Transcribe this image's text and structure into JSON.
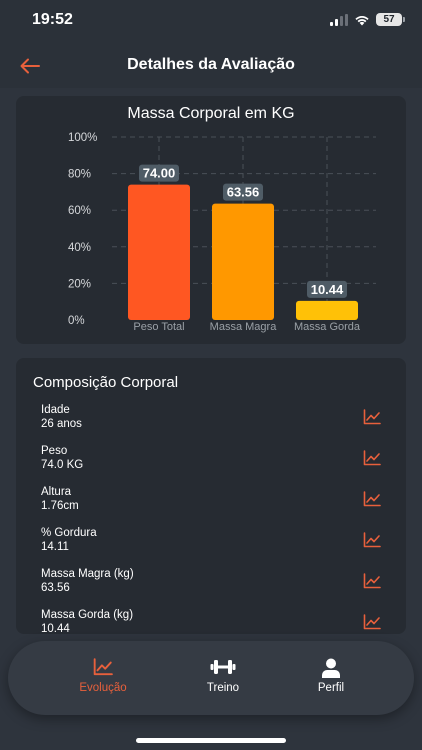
{
  "status": {
    "time": "19:52",
    "battery": "57"
  },
  "header": {
    "title": "Detalhes da Avaliação"
  },
  "chart_data": {
    "type": "bar",
    "title": "Massa Corporal em KG",
    "categories": [
      "Peso Total",
      "Massa Magra",
      "Massa Gorda"
    ],
    "values": [
      74.0,
      63.56,
      10.44
    ],
    "value_labels": [
      "74.00",
      "63.56",
      "10.44"
    ],
    "colors": [
      "#ff5722",
      "#ff9800",
      "#ffc107"
    ],
    "y_ticks": [
      "100%",
      "80%",
      "60%",
      "40%",
      "20%",
      "0%"
    ],
    "ylim": [
      0,
      100
    ],
    "grid": true
  },
  "composition": {
    "title": "Composição Corporal",
    "rows": [
      {
        "label": "Idade",
        "value": "26 anos",
        "icon": "chart-line-icon"
      },
      {
        "label": "Peso",
        "value": "74.0 KG",
        "icon": "chart-line-icon"
      },
      {
        "label": "Altura",
        "value": "1.76cm",
        "icon": "chart-line-icon"
      },
      {
        "label": "% Gordura",
        "value": "14.11",
        "icon": "chart-line-icon"
      },
      {
        "label": "Massa Magra (kg)",
        "value": "63.56",
        "icon": "chart-line-icon"
      },
      {
        "label": "Massa Gorda (kg)",
        "value": "10.44",
        "icon": "chart-line-icon"
      }
    ]
  },
  "nav": {
    "items": [
      {
        "label": "Evolução",
        "icon": "chart-line-icon",
        "active": true
      },
      {
        "label": "Treino",
        "icon": "dumbbell-icon",
        "active": false
      },
      {
        "label": "Perfil",
        "icon": "user-icon",
        "active": false
      }
    ]
  },
  "colors": {
    "accent": "#e8603c",
    "background": "#2e343d",
    "card": "#262b32"
  }
}
